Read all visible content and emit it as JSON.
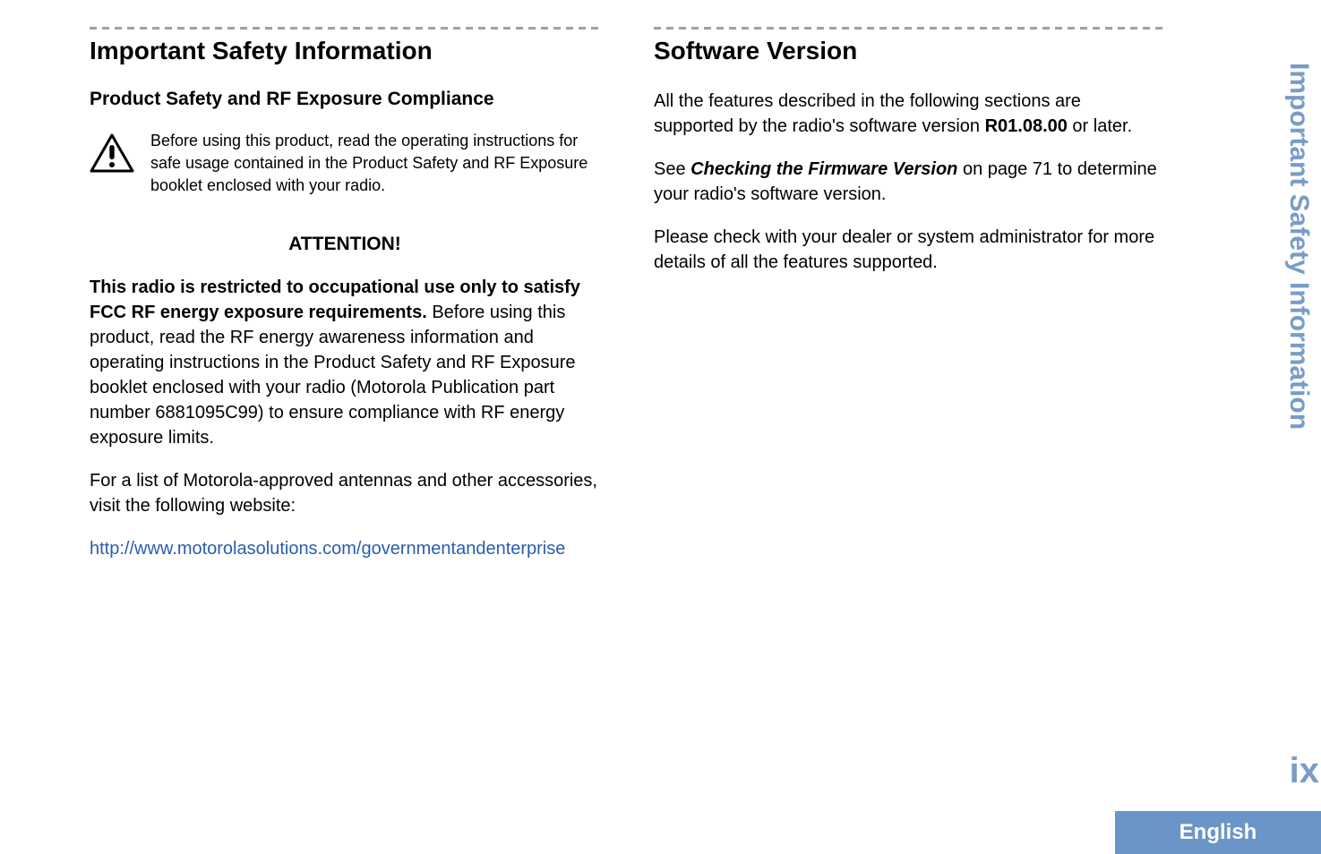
{
  "left_column": {
    "heading": "Important Safety Information",
    "subheading": "Product Safety and RF Exposure Compliance",
    "caution_text": "Before using this product, read the operating instructions for safe usage contained in the Product Safety and RF Exposure booklet enclosed with your radio.",
    "attention_heading": "ATTENTION!",
    "restricted_bold": "This radio is restricted to occupational use only to satisfy FCC RF energy exposure requirements.",
    "restricted_body": " Before using this product, read the RF energy awareness information and operating instructions in the Product Safety and RF Exposure booklet enclosed with your radio (Motorola Publication part number 6881095C99) to ensure compliance with RF energy exposure limits.",
    "accessories_text": "For a list of Motorola-approved antennas and other accessories, visit the following website:",
    "link_text": "http://www.motorolasolutions.com/governmentandenterprise"
  },
  "right_column": {
    "heading": "Software Version",
    "para1_prefix": "All the features described in the following sections are supported by the radio's software version ",
    "para1_bold": "R01.08.00",
    "para1_suffix": " or later.",
    "para2_prefix": "See ",
    "para2_italic_bold": "Checking the Firmware Version",
    "para2_suffix": " on page 71 to determine your radio's software version.",
    "para3": "Please check with your dealer or system administrator for more details of all the features supported."
  },
  "side_tab": {
    "text": "Important Safety Information",
    "page_number": "ix",
    "language": "English"
  }
}
